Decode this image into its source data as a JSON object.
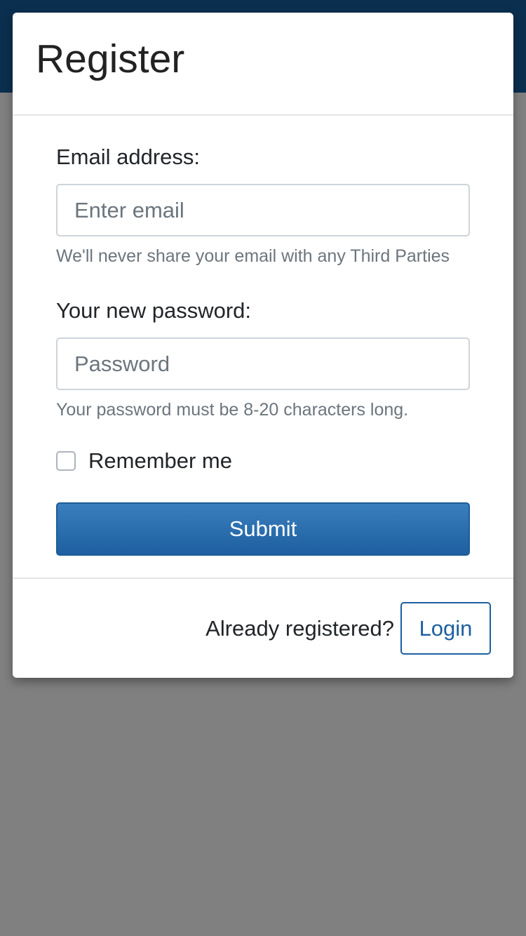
{
  "modal": {
    "title": "Register"
  },
  "form": {
    "email_label": "Email address:",
    "email_placeholder": "Enter email",
    "email_value": "",
    "email_help": "We'll never share your email with any Third Parties",
    "password_label": "Your new password:",
    "password_placeholder": "Password",
    "password_value": "",
    "password_help": "Your password must be 8-20 characters long.",
    "remember_label": "Remember me",
    "remember_checked": false,
    "submit_label": "Submit"
  },
  "footer": {
    "prompt": "Already registered?",
    "login_label": "Login"
  },
  "colors": {
    "header_bar": "#0b2f4f",
    "backdrop": "#808080",
    "primary": "#1d5fa0",
    "help_text": "#6c757d"
  }
}
